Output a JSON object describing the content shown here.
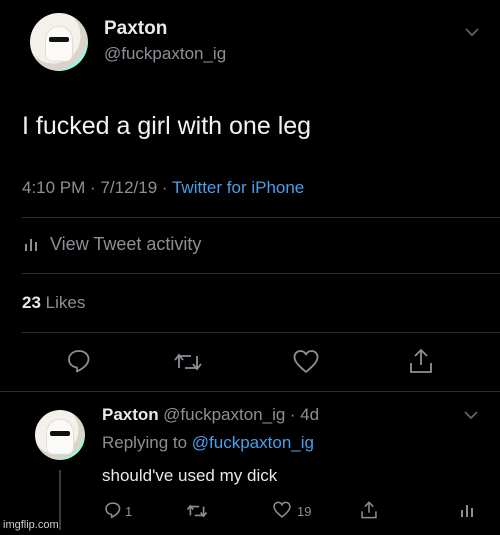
{
  "tweet": {
    "name": "Paxton",
    "handle": "@fuckpaxton_ig",
    "text": "I fucked a girl with one leg",
    "time": "4:10 PM",
    "date": "7/12/19",
    "source": "Twitter for iPhone",
    "activity_label": "View Tweet activity",
    "likes_count": "23",
    "likes_label": "Likes"
  },
  "reply": {
    "name": "Paxton",
    "handle": "@fuckpaxton_ig",
    "age": "4d",
    "replying_prefix": "Replying to",
    "replying_to": "@fuckpaxton_ig",
    "text": "should've used my dick",
    "reply_count": "1",
    "like_count": "19"
  },
  "icons": {
    "chevron": "chevron-down-icon",
    "reply": "reply-icon",
    "retweet": "retweet-icon",
    "like": "heart-icon",
    "share": "share-icon",
    "stats": "stats-icon"
  },
  "colors": {
    "background": "#000000",
    "link": "#4a9eea",
    "secondary": "#8b9096"
  },
  "watermark": "imgflip.com"
}
